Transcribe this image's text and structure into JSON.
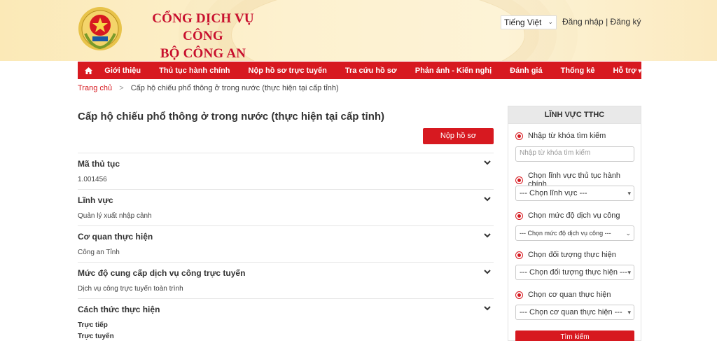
{
  "header": {
    "title_line1": "CỔNG DỊCH VỤ CÔNG",
    "title_line2": "BỘ CÔNG AN",
    "language": "Tiếng Việt",
    "login": "Đăng nhập",
    "auth_sep": "|",
    "register": "Đăng ký"
  },
  "nav": {
    "home_icon": "home-icon",
    "items": [
      "Giới thiệu",
      "Thủ tục hành chính",
      "Nộp hồ sơ trực tuyến",
      "Tra cứu hồ sơ",
      "Phản ánh - Kiến nghị",
      "Đánh giá",
      "Thống kê",
      "Hỗ trợ"
    ]
  },
  "breadcrumb": {
    "home": "Trang chủ",
    "separator": ">",
    "current": "Cấp hộ chiếu phổ thông ở trong nước (thực hiện tại cấp tỉnh)"
  },
  "main": {
    "title": "Cấp hộ chiếu phổ thông ở trong nước (thực hiện tại cấp tỉnh)",
    "submit_button": "Nộp hồ sơ",
    "sections": [
      {
        "label": "Mã thủ tục",
        "value": "1.001456"
      },
      {
        "label": "Lĩnh vực",
        "value": "Quản lý xuất nhập cảnh"
      },
      {
        "label": "Cơ quan thực hiện",
        "value": "Công an Tỉnh"
      },
      {
        "label": "Mức độ cung cấp dịch vụ công trực tuyến",
        "value": "Dịch vụ công trực tuyến toàn trình"
      },
      {
        "label": "Cách thức thực hiện",
        "values": [
          "Trực tiếp",
          "Trực tuyến"
        ]
      }
    ]
  },
  "sidebar": {
    "title": "LĨNH VỰC TTHC",
    "keyword_label": "Nhập từ khóa tìm kiếm",
    "keyword_placeholder": "Nhập từ khóa tìm kiếm",
    "field_label": "Chọn lĩnh vực thủ tục hành chính",
    "field_select": "--- Chọn lĩnh vực ---",
    "level_label": "Chọn mức độ dịch vụ công",
    "level_select": "--- Chọn mức độ dịch vụ công ---",
    "subject_label": "Chọn đối tượng thực hiện",
    "subject_select": "--- Chọn đối tượng thực hiện ---",
    "agency_label": "Chọn cơ quan thực hiện",
    "agency_select": "--- Chọn cơ quan thực hiện ---",
    "search_button": "Tìm kiếm"
  },
  "colors": {
    "brand_red": "#d71920",
    "title_red": "#c8102e",
    "header_bg": "#fdf1cf"
  }
}
